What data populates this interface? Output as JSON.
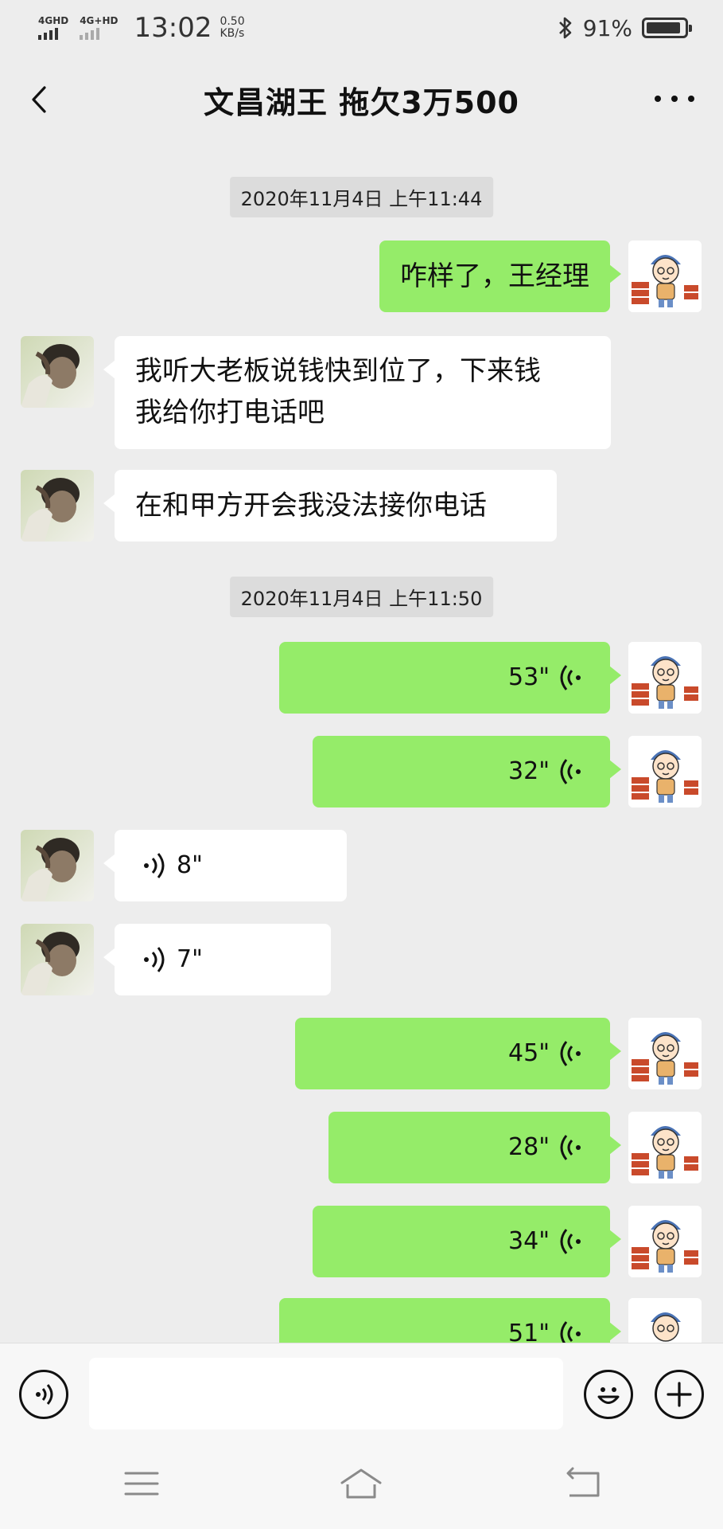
{
  "status_bar": {
    "signal1_label": "4GHD",
    "signal2_label": "4G+HD",
    "time": "13:02",
    "net_speed_value": "0.50",
    "net_speed_unit": "KB/s",
    "battery_percent": "91%",
    "battery_level": 0.91,
    "icons": [
      "signal-icon",
      "bluetooth-icon",
      "battery-icon"
    ]
  },
  "header": {
    "title": "文昌湖王  拖欠3万500",
    "back_icon": "chevron-left-icon",
    "more_icon": "more-dots-icon"
  },
  "messages": [
    {
      "kind": "timestamp",
      "text": "2020年11月4日 上午11:44"
    },
    {
      "kind": "text",
      "sender": "me",
      "lines": [
        "咋样了，王经理"
      ]
    },
    {
      "kind": "text",
      "sender": "them",
      "lines": [
        "我听大老板说钱快到位了，下来钱",
        "我给你打电话吧"
      ]
    },
    {
      "kind": "text",
      "sender": "them",
      "lines": [
        "在和甲方开会我没法接你电话"
      ]
    },
    {
      "kind": "timestamp",
      "text": "2020年11月4日 上午11:50"
    },
    {
      "kind": "voice",
      "sender": "me",
      "duration": "53\""
    },
    {
      "kind": "voice",
      "sender": "me",
      "duration": "32\""
    },
    {
      "kind": "voice",
      "sender": "them",
      "duration": "8\""
    },
    {
      "kind": "voice",
      "sender": "them",
      "duration": "7\""
    },
    {
      "kind": "voice",
      "sender": "me",
      "duration": "45\""
    },
    {
      "kind": "voice",
      "sender": "me",
      "duration": "28\""
    },
    {
      "kind": "voice",
      "sender": "me",
      "duration": "34\""
    },
    {
      "kind": "voice",
      "sender": "me",
      "duration": "51\""
    }
  ],
  "input_bar": {
    "voice_toggle_icon": "voice-mode-icon",
    "text_value": "",
    "emoji_icon": "emoji-icon",
    "plus_icon": "plus-icon"
  },
  "nav_bar": {
    "icons": [
      "menu-icon",
      "home-icon",
      "back-icon"
    ]
  },
  "colors": {
    "background": "#ededed",
    "bubble_me": "#95ec69",
    "bubble_them": "#ffffff",
    "timestamp_bg": "#dcdcdc"
  }
}
